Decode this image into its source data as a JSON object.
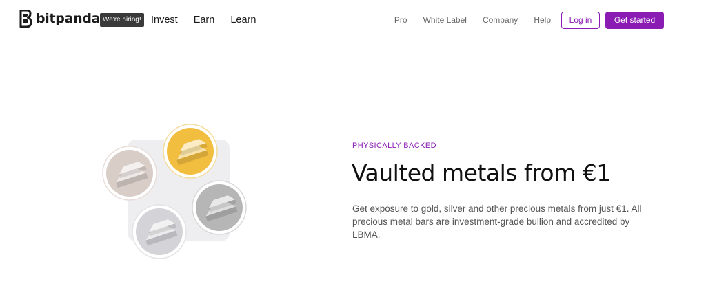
{
  "header": {
    "logo_text": "bitpanda",
    "hiring_badge": "We're hiring!",
    "nav_main": [
      {
        "label": "Invest"
      },
      {
        "label": "Earn"
      },
      {
        "label": "Learn"
      }
    ],
    "nav_secondary": [
      {
        "label": "Pro"
      },
      {
        "label": "White Label"
      },
      {
        "label": "Company"
      },
      {
        "label": "Help"
      }
    ],
    "login_label": "Log in",
    "get_started_label": "Get started"
  },
  "hero": {
    "eyebrow": "PHYSICALLY BACKED",
    "title": "Vaulted metals from €1",
    "description": "Get exposure to gold, silver and other precious metals from just €1. All precious metal bars are investment-grade bullion and accredited by LBMA.",
    "illustration": {
      "coins": [
        {
          "metal": "gold",
          "color": "#f2be3f",
          "icon": "gold-bars-icon"
        },
        {
          "metal": "rose",
          "color": "#d9cdc8",
          "icon": "rose-bars-icon"
        },
        {
          "metal": "platinum",
          "color": "#b6b6b6",
          "icon": "platinum-bars-icon"
        },
        {
          "metal": "silver",
          "color": "#d3d3d8",
          "icon": "silver-bars-icon"
        }
      ]
    }
  },
  "colors": {
    "brand": "#8a1bb3",
    "text": "#111111",
    "muted": "#555555"
  }
}
